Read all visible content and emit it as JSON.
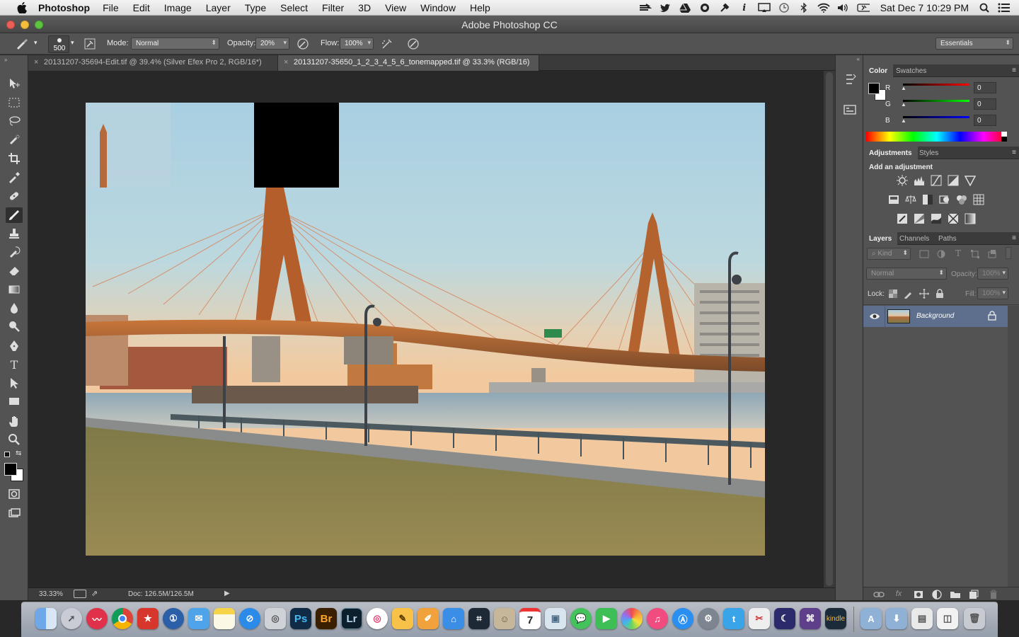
{
  "menubar": {
    "app_name": "Photoshop",
    "menus": [
      "File",
      "Edit",
      "Image",
      "Layer",
      "Type",
      "Select",
      "Filter",
      "3D",
      "View",
      "Window",
      "Help"
    ],
    "clock": "Sat Dec 7  10:29 PM",
    "status_icons": [
      "swoosh-icon",
      "twitter-icon",
      "drive-icon",
      "camera-icon",
      "tool-icon",
      "info-icon",
      "display-icon",
      "time-machine-icon",
      "bluetooth-icon",
      "wifi-icon",
      "volume-icon",
      "battery-icon",
      "spotlight-icon",
      "notification-center-icon"
    ]
  },
  "window": {
    "title": "Adobe Photoshop CC"
  },
  "options": {
    "brush_size": "500",
    "mode_label": "Mode:",
    "mode_value": "Normal",
    "opacity_label": "Opacity:",
    "opacity_value": "20%",
    "flow_label": "Flow:",
    "flow_value": "100%",
    "workspace": "Essentials"
  },
  "tabs": [
    {
      "title": "20131207-35694-Edit.tif @ 39.4% (Silver Efex Pro 2, RGB/16*)",
      "active": false
    },
    {
      "title": "20131207-35650_1_2_3_4_5_6_tonemapped.tif @ 33.3% (RGB/16)",
      "active": true
    }
  ],
  "tools": [
    "move-tool",
    "marquee-tool",
    "lasso-tool",
    "quick-select-tool",
    "crop-tool",
    "eyedropper-tool",
    "healing-brush-tool",
    "brush-tool",
    "clone-stamp-tool",
    "history-brush-tool",
    "eraser-tool",
    "gradient-tool",
    "blur-tool",
    "dodge-tool",
    "pen-tool",
    "type-tool",
    "path-select-tool",
    "rectangle-tool",
    "hand-tool",
    "zoom-tool"
  ],
  "status": {
    "zoom": "33.33%",
    "doc": "Doc: 126.5M/126.5M"
  },
  "color_panel": {
    "tabs": [
      "Color",
      "Swatches"
    ],
    "channels": [
      {
        "label": "R",
        "value": "0"
      },
      {
        "label": "G",
        "value": "0"
      },
      {
        "label": "B",
        "value": "0"
      }
    ],
    "fg_color": "#000000",
    "bg_color": "#ffffff"
  },
  "adjustments_panel": {
    "tabs": [
      "Adjustments",
      "Styles"
    ],
    "heading": "Add an adjustment"
  },
  "layers_panel": {
    "tabs": [
      "Layers",
      "Channels",
      "Paths"
    ],
    "kind_label": "Kind",
    "blend_mode": "Normal",
    "opacity_label": "Opacity:",
    "opacity_value": "100%",
    "lock_label": "Lock:",
    "fill_label": "Fill:",
    "fill_value": "100%",
    "layers": [
      {
        "name": "Background",
        "visible": true,
        "locked": true
      }
    ]
  },
  "dock": {
    "app_labels": {
      "ps": "Ps",
      "br": "Br",
      "lr": "Lr",
      "kindle": "kindle",
      "calendar_day": "7"
    }
  }
}
